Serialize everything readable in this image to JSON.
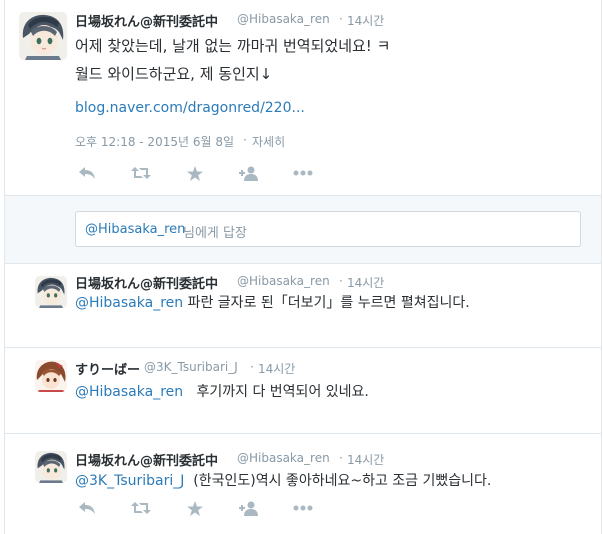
{
  "main_tweet": {
    "display_name": "日場坂れん@新刊委託中",
    "handle": "@Hibasaka_ren",
    "separator": "·",
    "time_ago": "14시간",
    "text_line1": "어제 찾았는데, 날개 없는 까마귀 번역되었네요! ㅋ",
    "text_line2": "월드 와이드하군요, 제 동인지↓",
    "link": "blog.naver.com/dragonred/220...",
    "timestamp": "오후 12:18 - 2015년 6월 8일",
    "details_label": "자세히"
  },
  "reply_box": {
    "mention": "@Hibasaka_ren",
    "suffix": "님에게 답장"
  },
  "replies": [
    {
      "display_name": "日場坂れん@新刊委託中",
      "handle": "@Hibasaka_ren",
      "separator": "·",
      "time_ago": "14시간",
      "mention": "@Hibasaka_ren",
      "text": "파란 글자로 된「더보기」를 누르면 펼쳐집니다."
    },
    {
      "display_name": "すりーばー",
      "handle": "@3K_Tsuribari_J",
      "separator": "·",
      "time_ago": "14시간",
      "mention": "@Hibasaka_ren",
      "text": "후기까지 다 번역되어 있네요."
    },
    {
      "display_name": "日場坂れん@新刊委託中",
      "handle": "@Hibasaka_ren",
      "separator": "·",
      "time_ago": "14시간",
      "mention": "@3K_Tsuribari_J",
      "text": "(한국인도)역시 좋아하네요~하고 조금 기뻤습니다."
    }
  ],
  "icons": [
    "reply-icon",
    "retweet-icon",
    "favorite-icon",
    "follow-icon",
    "more-icon"
  ],
  "colors": {
    "link": "#2b7bb9",
    "muted": "#8899a6",
    "icon": "#aab8c2",
    "text": "#292f33",
    "reply_bg": "#f5f8fa",
    "border": "#e1e8ed"
  }
}
